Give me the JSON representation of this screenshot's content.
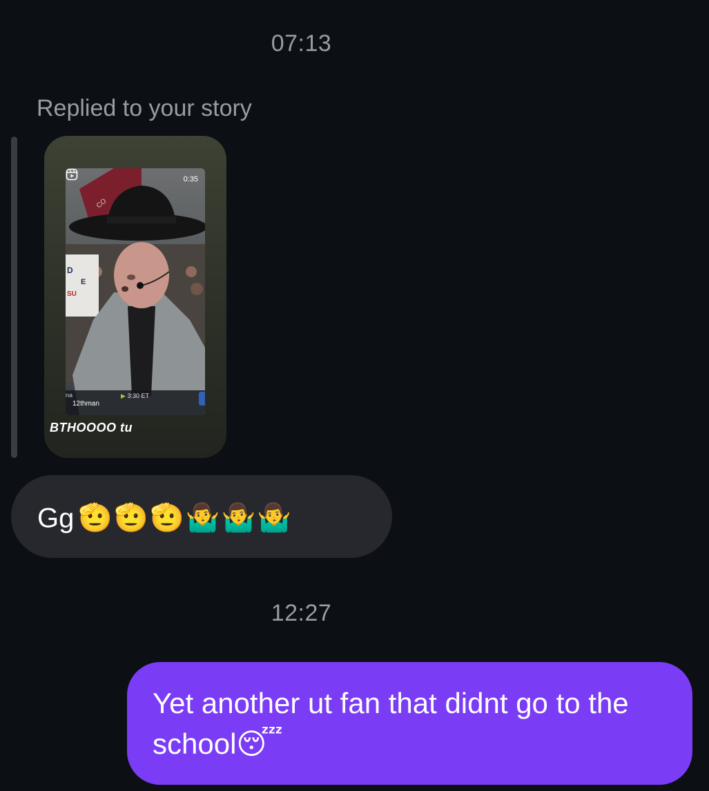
{
  "timestamps": [
    "07:13",
    "12:27"
  ],
  "reply": {
    "context_label": "Replied to your story",
    "story": {
      "video_duration": "0:35",
      "ticker_left": "na",
      "ticker_handle": "12thman",
      "ticker_time": "3:30 ET",
      "caption": "BTHOOOO tu"
    }
  },
  "messages": {
    "incoming": {
      "text": "Gg",
      "emoji": "🫡🫡🫡🤷‍♂️🤷‍♂️🤷‍♂️"
    },
    "outgoing": {
      "text": "Yet another ut fan that didnt go to the school😴"
    }
  },
  "colors": {
    "background": "#0c0f14",
    "incoming_bubble": "#26282d",
    "outgoing_bubble": "#7b3cf5",
    "muted_text": "#9a9ca3"
  }
}
